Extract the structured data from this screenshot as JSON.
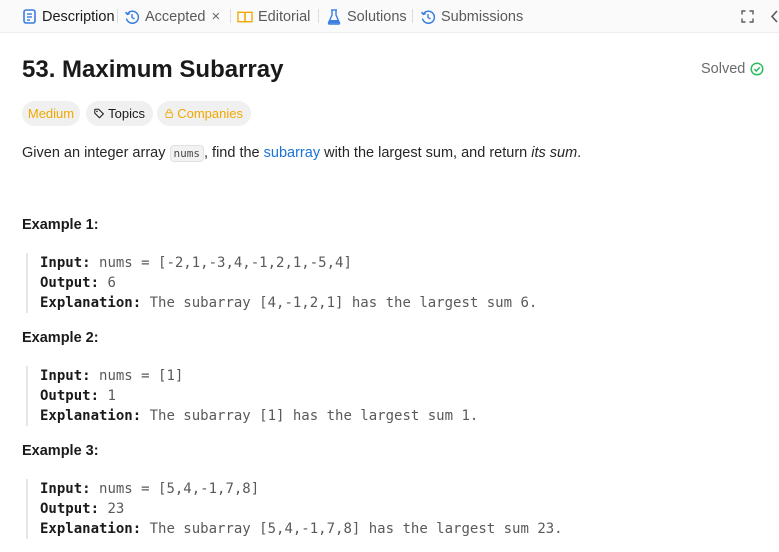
{
  "tabs": {
    "description": "Description",
    "accepted": "Accepted",
    "editorial": "Editorial",
    "solutions": "Solutions",
    "submissions": "Submissions"
  },
  "problem": {
    "title": "53. Maximum Subarray",
    "status": "Solved",
    "difficulty": "Medium",
    "topics_label": "Topics",
    "companies_label": "Companies",
    "description": {
      "p1": "Given an integer array ",
      "code": "nums",
      "p2": ", find the ",
      "link": "subarray",
      "p3": " with the largest sum, and return ",
      "em": "its sum",
      "p4": "."
    }
  },
  "labels": {
    "input": "Input:",
    "output": "Output:",
    "explanation": "Explanation:"
  },
  "examples": [
    {
      "title": "Example 1:",
      "input": "nums = [-2,1,-3,4,-1,2,1,-5,4]",
      "output": "6",
      "explanation": "The subarray [4,-1,2,1] has the largest sum 6."
    },
    {
      "title": "Example 2:",
      "input": "nums = [1]",
      "output": "1",
      "explanation": "The subarray [1] has the largest sum 1."
    },
    {
      "title": "Example 3:",
      "input": "nums = [5,4,-1,7,8]",
      "output": "23",
      "explanation": "The subarray [5,4,-1,7,8] has the largest sum 23."
    }
  ],
  "colors": {
    "medium": "#f0a800",
    "link": "#1a73d9",
    "solved_check": "#2cbb5d",
    "description_icon": "#3b7de0",
    "editorial_icon": "#f0a800",
    "solutions_icon": "#3b7de0",
    "history_icon": "#3b7de0"
  },
  "icons": {
    "description": "description-icon",
    "accepted": "history-icon",
    "editorial": "book-icon",
    "solutions": "flask-icon",
    "submissions": "history-icon",
    "expand": "expand-icon",
    "collapse": "chevron-left-icon",
    "solved": "check-circle-icon",
    "topics": "tag-icon",
    "companies": "lock-icon"
  }
}
